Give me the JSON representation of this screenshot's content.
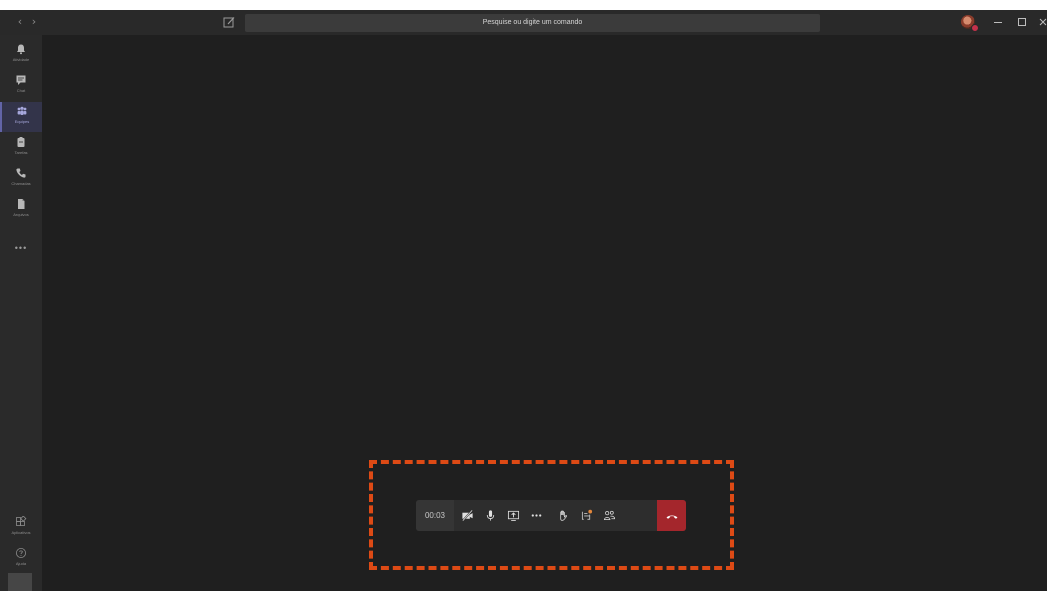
{
  "titlebar": {
    "back_glyph": "‹",
    "forward_glyph": "›",
    "search_placeholder": "Pesquise ou digite um comando",
    "icons": [
      "back-arrow-icon",
      "forward-arrow-icon",
      "compose-icon",
      "avatar",
      "minimize-icon",
      "maximize-icon",
      "close-icon"
    ]
  },
  "rail": {
    "items": [
      {
        "label": "Atividade",
        "icon": "bell-icon"
      },
      {
        "label": "Chat",
        "icon": "chat-icon"
      },
      {
        "label": "Equipes",
        "icon": "teams-icon",
        "active": true
      },
      {
        "label": "Tarefas",
        "icon": "tasks-icon"
      },
      {
        "label": "Chamadas",
        "icon": "phone-icon"
      },
      {
        "label": "Arquivos",
        "icon": "files-icon"
      }
    ],
    "more": "•••",
    "bottom": [
      {
        "label": "Aplicativos",
        "icon": "apps-icon"
      },
      {
        "label": "Ajuda",
        "icon": "help-icon"
      }
    ]
  },
  "call": {
    "timer": "00:03",
    "buttons": [
      "camera-off-icon",
      "microphone-icon",
      "share-screen-icon",
      "more-actions-icon",
      "raise-hand-icon",
      "chat-icon",
      "participants-icon",
      "hang-up-icon"
    ]
  },
  "colors": {
    "background": "#1f1f1f",
    "titlebar": "#292929",
    "rail": "#2a2a2a",
    "accent": "#6264a7",
    "hangup": "#a4262c",
    "highlight": "#dd4a15"
  }
}
